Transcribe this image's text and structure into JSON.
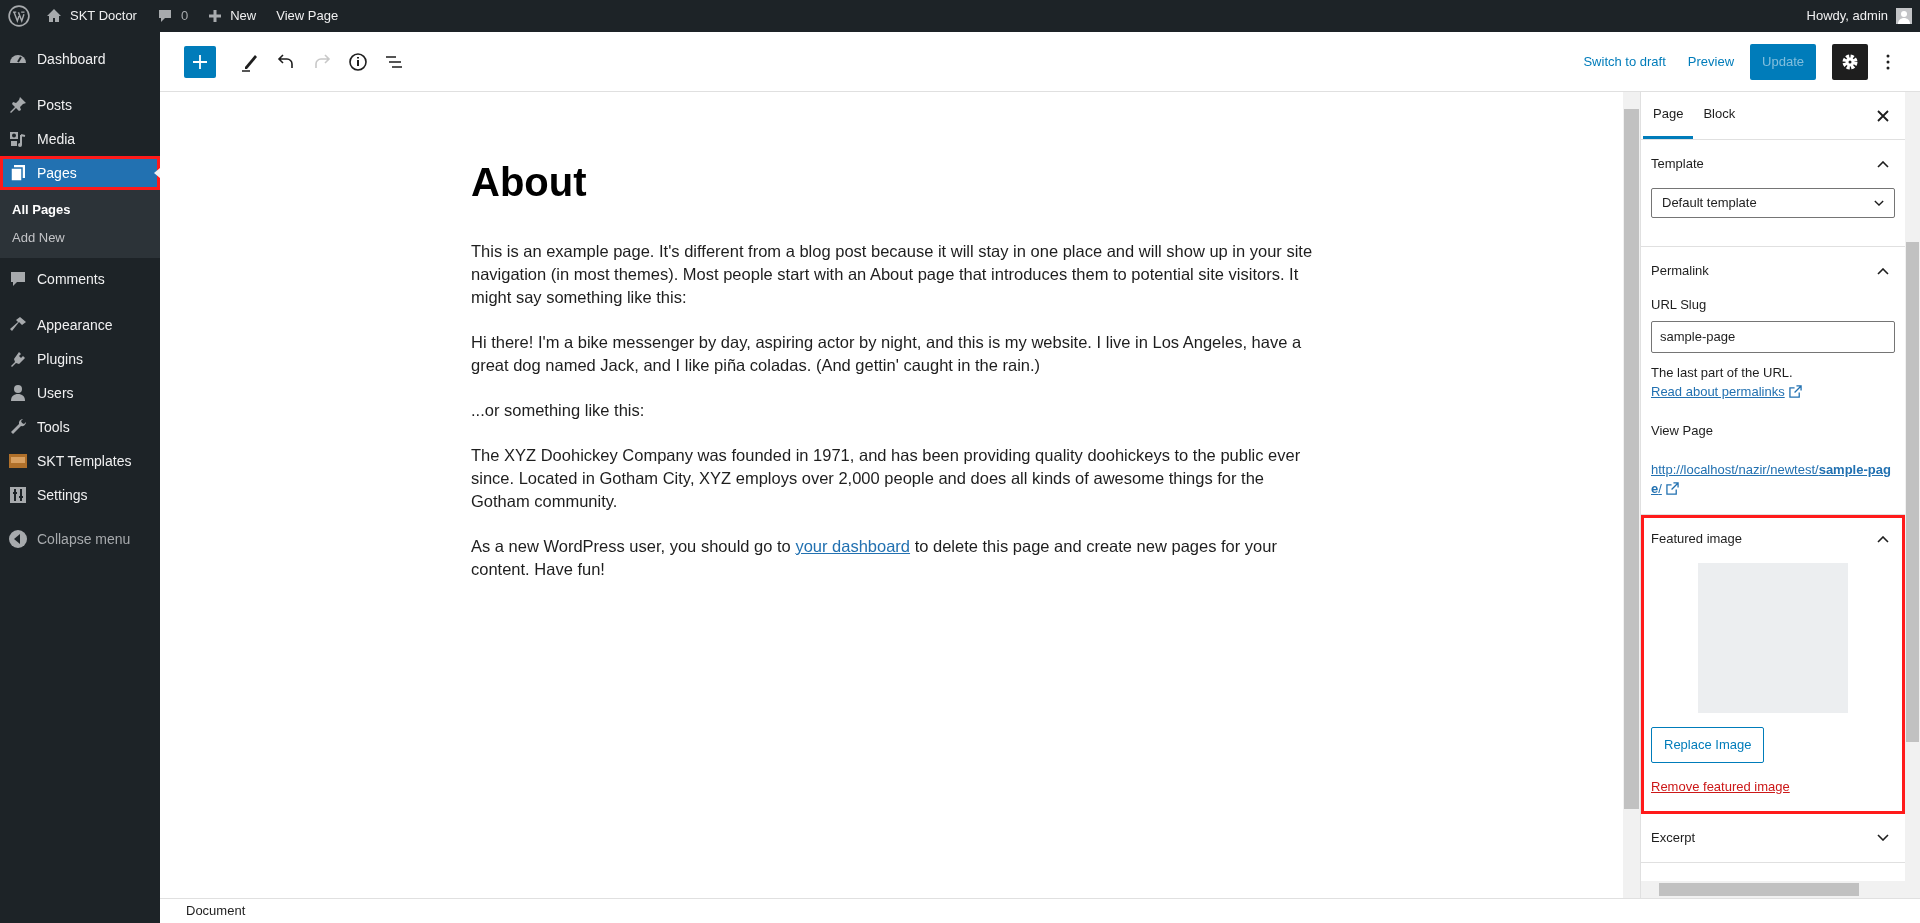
{
  "admin_bar": {
    "site_name": "SKT Doctor",
    "comments_count": "0",
    "new_label": "New",
    "view_page_label": "View Page",
    "greeting": "Howdy, admin"
  },
  "sidebar": {
    "items": [
      {
        "label": "Dashboard",
        "selected": false,
        "highlighted": false
      },
      {
        "label": "Posts",
        "selected": false,
        "highlighted": false
      },
      {
        "label": "Media",
        "selected": false,
        "highlighted": false
      },
      {
        "label": "Pages",
        "selected": true,
        "highlighted": true,
        "children": [
          {
            "label": "All Pages",
            "selected": true
          },
          {
            "label": "Add New",
            "selected": false
          }
        ]
      },
      {
        "label": "Comments",
        "selected": false,
        "highlighted": false
      },
      {
        "label": "Appearance",
        "selected": false,
        "highlighted": false
      },
      {
        "label": "Plugins",
        "selected": false,
        "highlighted": false
      },
      {
        "label": "Users",
        "selected": false,
        "highlighted": false
      },
      {
        "label": "Tools",
        "selected": false,
        "highlighted": false
      },
      {
        "label": "SKT Templates",
        "selected": false,
        "highlighted": false
      },
      {
        "label": "Settings",
        "selected": false,
        "highlighted": false
      }
    ],
    "collapse_label": "Collapse menu"
  },
  "toolbar": {
    "switch_to_draft": "Switch to draft",
    "preview": "Preview",
    "update": {
      "label": "Update",
      "disabled": true
    },
    "settings_active": true
  },
  "editor": {
    "title": "About",
    "paragraphs": [
      {
        "text": "This is an example page. It's different from a blog post because it will stay in one place and will show up in your site navigation (in most themes). Most people start with an About page that introduces them to potential site visitors. It might say something like this:"
      },
      {
        "text": "Hi there! I'm a bike messenger by day, aspiring actor by night, and this is my website. I live in Los Angeles, have a great dog named Jack, and I like piña coladas. (And gettin' caught in the rain.)"
      },
      {
        "text": "...or something like this:"
      },
      {
        "text": "The XYZ Doohickey Company was founded in 1971, and has been providing quality doohickeys to the public ever since. Located in Gotham City, XYZ employs over 2,000 people and does all kinds of awesome things for the Gotham community."
      },
      {
        "text": "As a new WordPress user, you should go to ",
        "link": "your dashboard",
        "after": " to delete this page and create new pages for your content. Have fun!"
      }
    ]
  },
  "panel": {
    "tabs": [
      {
        "label": "Page",
        "selected": true
      },
      {
        "label": "Block",
        "selected": false
      }
    ],
    "sections": [
      {
        "kind": "template",
        "title": "Template",
        "expanded": true,
        "highlighted": false,
        "select_value": "Default template"
      },
      {
        "kind": "permalink",
        "title": "Permalink",
        "expanded": true,
        "highlighted": false,
        "slug_label": "URL Slug",
        "slug_value": "sample-page",
        "help_text": "The last part of the URL. ",
        "help_link": "Read about permalinks",
        "view_label": "View Page",
        "url": "http://localhost/nazir/newtest/**sample-page**/"
      },
      {
        "kind": "featured_image",
        "title": "Featured image",
        "expanded": true,
        "highlighted": true,
        "replace_label": "Replace Image",
        "remove_label": "Remove featured image"
      },
      {
        "kind": "excerpt",
        "title": "Excerpt",
        "expanded": false,
        "highlighted": false
      }
    ]
  },
  "status_bar": {
    "breadcrumb": "Document"
  }
}
